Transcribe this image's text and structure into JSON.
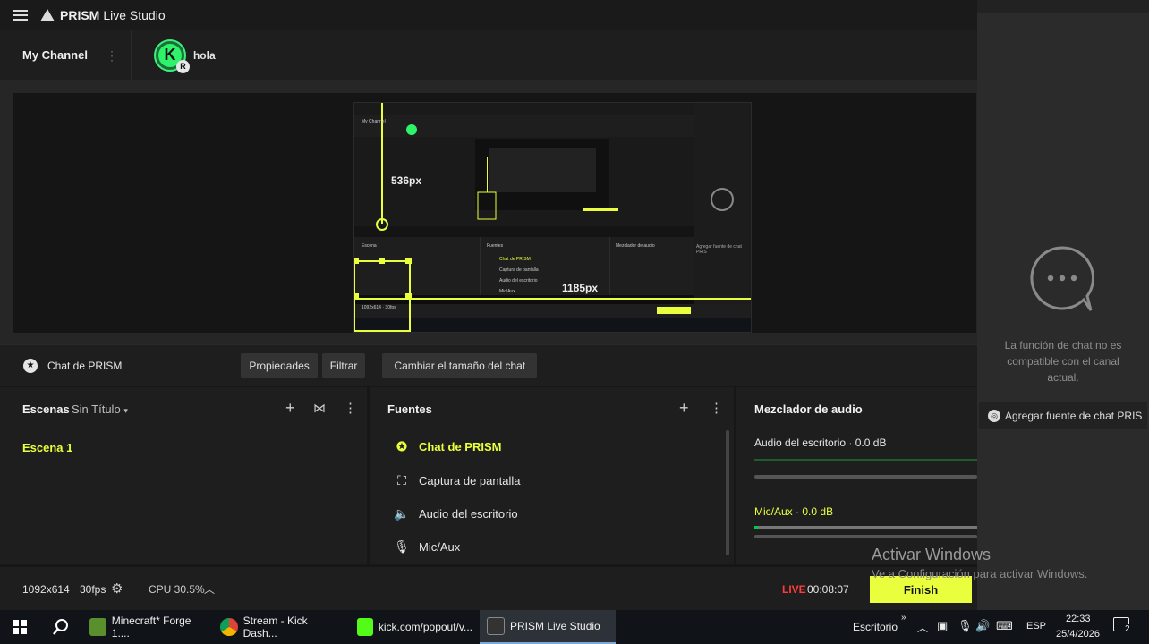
{
  "app": {
    "title_bold": "PRISM",
    "title_light": "Live Studio"
  },
  "channel": {
    "my_channel": "My Channel",
    "avatar_letter": "K",
    "badge_letter": "R",
    "name": "hola"
  },
  "preview": {
    "label_height": "536px",
    "label_width": "1185px",
    "inner_my_channel": "My Channel",
    "inner_escena": "Escena",
    "inner_fuentes": "Fuentes",
    "inner_mezclador": "Mezclador de audio",
    "inner_chat": "Chat de PRISM",
    "inner_captura": "Captura de pantalla",
    "inner_audio": "Audio del escritorio",
    "inner_mic": "Mic/Aux",
    "inner_res": "1092x614 · 30fps",
    "inner_add_chat": "Agregar fuente de chat PRIS"
  },
  "chat_source": {
    "name": "Chat de PRISM",
    "btn_properties": "Propiedades",
    "btn_filter": "Filtrar",
    "btn_resize": "Cambiar el tamaño del chat"
  },
  "scenes": {
    "title": "Escenas",
    "collection": "Sin Título",
    "items": [
      {
        "label": "Escena 1"
      }
    ]
  },
  "sources": {
    "title": "Fuentes",
    "items": [
      {
        "label": "Chat de PRISM",
        "icon": "chat-star-icon"
      },
      {
        "label": "Captura de pantalla",
        "icon": "screen-capture-icon"
      },
      {
        "label": "Audio del escritorio",
        "icon": "speaker-icon"
      },
      {
        "label": "Mic/Aux",
        "icon": "mic-icon"
      }
    ]
  },
  "mixer": {
    "title": "Mezclador de audio",
    "channels": [
      {
        "name": "Audio del escritorio",
        "level": "0.0 dB"
      },
      {
        "name": "Mic/Aux",
        "level": "0.0 dB"
      }
    ]
  },
  "status": {
    "resolution": "1092x614",
    "fps": "30fps",
    "cpu": "CPU 30.5%",
    "live": "LIVE",
    "timer": "00:08:07",
    "finish": "Finish"
  },
  "chat_panel": {
    "message": "La función de chat no es compatible con el canal actual.",
    "add_source": "Agregar fuente de chat PRIS"
  },
  "watermark": {
    "line1": "Activar Windows",
    "line2": "Ve a Configuración para activar Windows."
  },
  "taskbar": {
    "apps": [
      {
        "label": "Minecraft* Forge 1...."
      },
      {
        "label": "Stream - Kick Dash..."
      },
      {
        "label": "kick.com/popout/v..."
      },
      {
        "label": "PRISM Live Studio"
      }
    ],
    "desktop": "Escritorio",
    "lang": "ESP",
    "time": "22:33",
    "date": "25/4/2026",
    "notif_count": "2"
  },
  "colors": {
    "accent": "#e9ff3d",
    "live": "#ff3b3b",
    "mic_level": "#00c853"
  }
}
